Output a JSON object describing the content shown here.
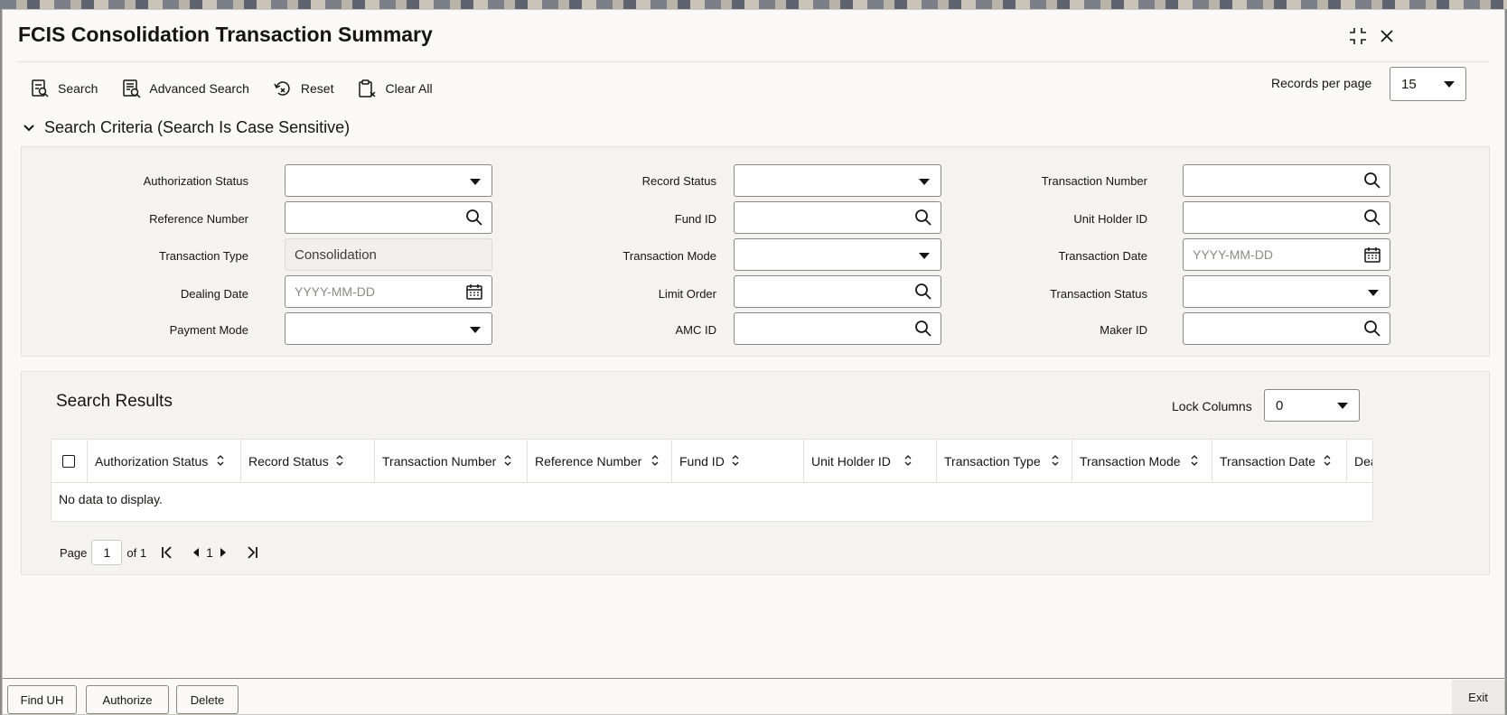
{
  "window": {
    "title": "FCIS Consolidation Transaction Summary"
  },
  "toolbar": {
    "search_label": "Search",
    "advanced_search_label": "Advanced Search",
    "reset_label": "Reset",
    "clear_all_label": "Clear All",
    "records_per_page_label": "Records per page",
    "records_per_page_value": "15"
  },
  "criteria": {
    "header": "Search Criteria (Search Is Case Sensitive)",
    "authorization_status": {
      "label": "Authorization Status",
      "value": ""
    },
    "record_status": {
      "label": "Record Status",
      "value": ""
    },
    "transaction_number": {
      "label": "Transaction Number",
      "value": ""
    },
    "reference_number": {
      "label": "Reference Number",
      "value": ""
    },
    "fund_id": {
      "label": "Fund ID",
      "value": ""
    },
    "unit_holder_id": {
      "label": "Unit Holder ID",
      "value": ""
    },
    "transaction_type": {
      "label": "Transaction Type",
      "value": "Consolidation"
    },
    "transaction_mode": {
      "label": "Transaction Mode",
      "value": ""
    },
    "transaction_date": {
      "label": "Transaction Date",
      "placeholder": "YYYY-MM-DD"
    },
    "dealing_date": {
      "label": "Dealing Date",
      "placeholder": "YYYY-MM-DD"
    },
    "limit_order": {
      "label": "Limit Order",
      "value": ""
    },
    "transaction_status": {
      "label": "Transaction Status",
      "value": ""
    },
    "payment_mode": {
      "label": "Payment Mode",
      "value": ""
    },
    "amc_id": {
      "label": "AMC ID",
      "value": ""
    },
    "maker_id": {
      "label": "Maker ID",
      "value": ""
    }
  },
  "results": {
    "title": "Search Results",
    "lock_columns_label": "Lock Columns",
    "lock_columns_value": "0",
    "columns": [
      "Authorization Status",
      "Record Status",
      "Transaction Number",
      "Reference Number",
      "Fund ID",
      "Unit Holder ID",
      "Transaction Type",
      "Transaction Mode",
      "Transaction Date",
      "Dea"
    ],
    "empty_message": "No data to display.",
    "pager": {
      "page_label": "Page",
      "page_value": "1",
      "of_label": "of 1",
      "current": "1"
    }
  },
  "footer": {
    "find_uh_label": "Find UH",
    "authorize_label": "Authorize",
    "delete_label": "Delete",
    "exit_label": "Exit"
  }
}
